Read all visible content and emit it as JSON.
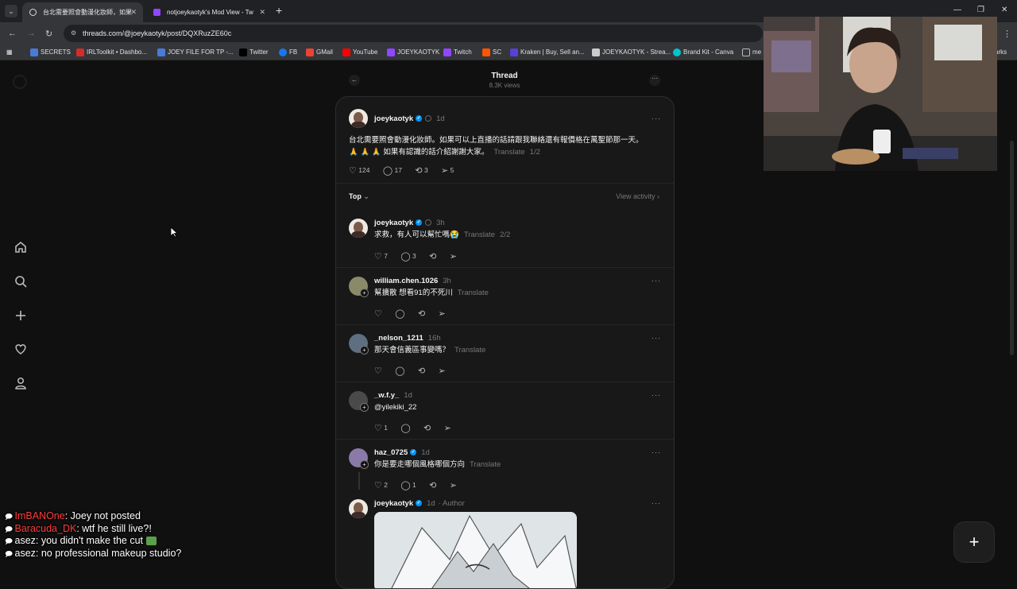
{
  "browser": {
    "tabs": [
      {
        "label": "台北需要照會動漫化妝師，如果",
        "active": true
      },
      {
        "label": "notjoeykaotyk's Mod View - Tw",
        "active": false
      }
    ],
    "url": "threads.com/@joeykaotyk/post/DQXRuzZE60c",
    "bookmarks": [
      "SECRETS",
      "IRLToolkit • Dashbo...",
      "JOEY FILE FOR TP -...",
      "Twitter",
      "FB",
      "GMail",
      "YouTube",
      "JOEYKAOTYK",
      "Twitch",
      "SC",
      "Kraken | Buy, Sell an...",
      "JOEYKAOTYK - Strea...",
      "Brand Kit - Canva",
      "me",
      "arks"
    ]
  },
  "header": {
    "title": "Thread",
    "views": "8.3K views"
  },
  "post": {
    "username": "joeykaotyk",
    "time": "1d",
    "text_line1": "台北需要照會動漫化妝師。如果可以上直播的話請跟我聯絡還有報價格在萬聖節那一天。",
    "text_line2": "🙏 🙏 🙏  如果有認識的話介紹謝謝大家。",
    "translate": "Translate",
    "page": "1/2",
    "likes": "124",
    "replies": "17",
    "reposts": "3",
    "shares": "5"
  },
  "sort": {
    "label": "Top",
    "view_activity": "View activity"
  },
  "replies": [
    {
      "username": "joeykaotyk",
      "time": "3h",
      "text": "求救，有人可以幫忙嗎😭",
      "translate": "Translate",
      "page": "2/2",
      "likes": "7",
      "replies": "3",
      "verified": true
    },
    {
      "username": "william.chen.1026",
      "time": "3h",
      "text": "幫擴散 想看91的不死川",
      "translate": "Translate",
      "likes": "",
      "replies": ""
    },
    {
      "username": "_nelson_1211",
      "time": "16h",
      "text": "那天會信義區事變嗎？",
      "translate": "Translate",
      "likes": "",
      "replies": ""
    },
    {
      "username": "_w.f.y_",
      "time": "1d",
      "text": "@yilekiki_22",
      "translate": "",
      "likes": "1",
      "replies": ""
    },
    {
      "username": "haz_0725",
      "time": "1d",
      "text": "你是要走哪個風格哪個方向",
      "translate": "Translate",
      "likes": "2",
      "replies": "1",
      "verified": true
    },
    {
      "username": "joeykaotyk",
      "time": "1d",
      "author": "Author",
      "verified": true
    }
  ],
  "chat": [
    {
      "user": "ImBANOne",
      "message": ": Joey not posted"
    },
    {
      "user": "Baracuda_DK",
      "message": ": wtf he still live?!"
    },
    {
      "user": "asez",
      "message": ": you didn't make the cut"
    },
    {
      "user": "asez",
      "message": ": no professional makeup studio?"
    }
  ],
  "colors": {
    "background": "#101010",
    "card": "#181818",
    "verified": "#0095f6",
    "chat_name_red": "#ff3b3b"
  }
}
